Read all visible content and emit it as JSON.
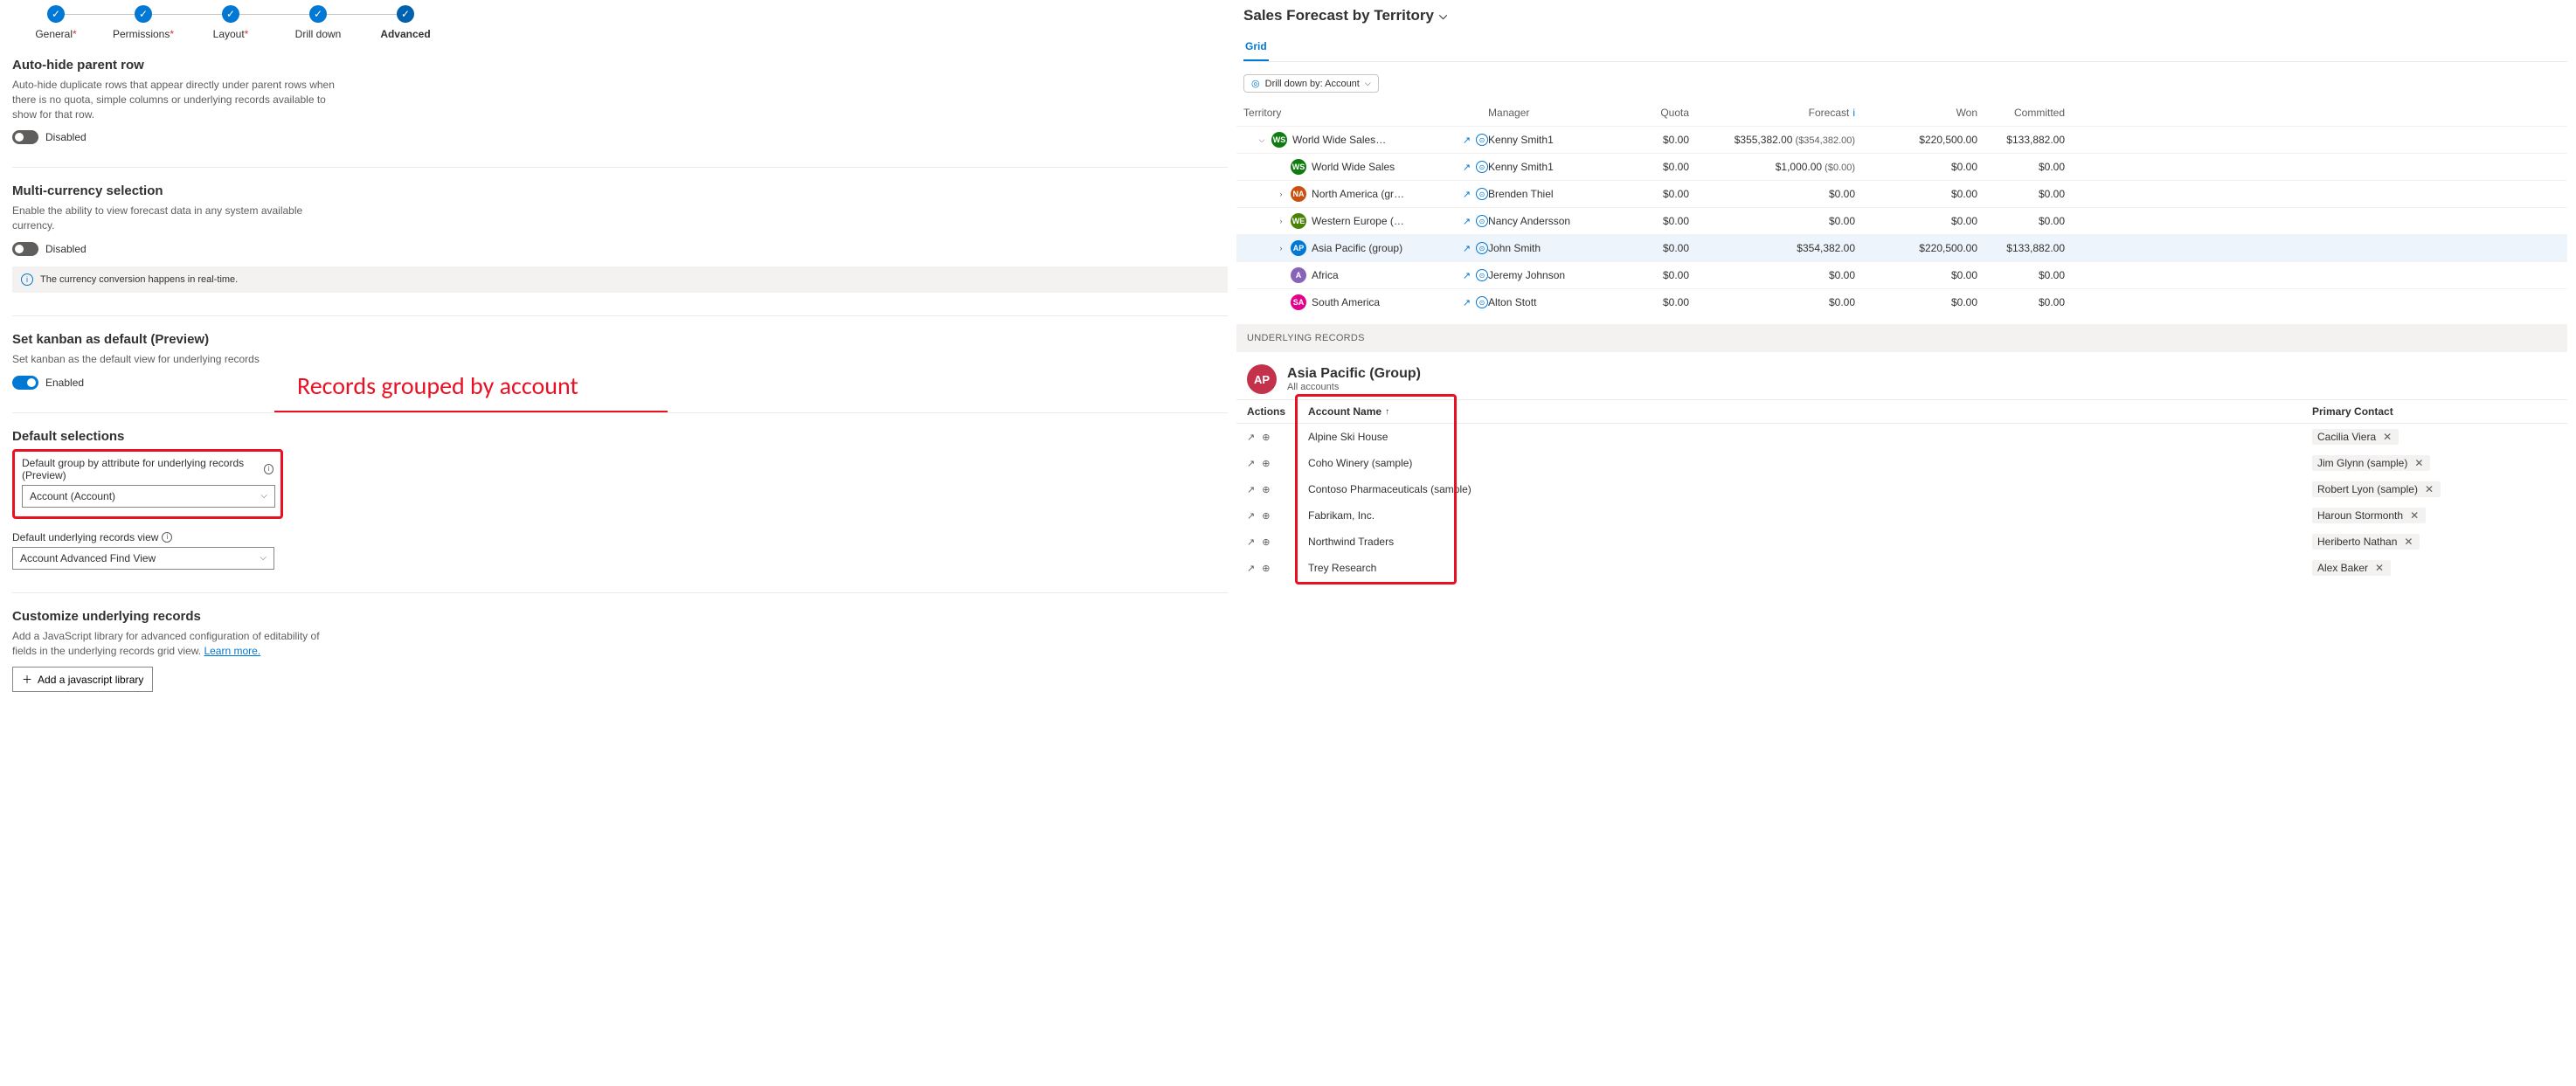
{
  "stepper": [
    {
      "label": "General",
      "req": true,
      "done": true,
      "current": false
    },
    {
      "label": "Permissions",
      "req": true,
      "done": true,
      "current": false
    },
    {
      "label": "Layout",
      "req": true,
      "done": true,
      "current": false
    },
    {
      "label": "Drill down",
      "req": false,
      "done": true,
      "current": false
    },
    {
      "label": "Advanced",
      "req": false,
      "done": true,
      "current": true
    }
  ],
  "sections": {
    "autoHide": {
      "title": "Auto-hide parent row",
      "desc": "Auto-hide duplicate rows that appear directly under parent rows when there is no quota, simple columns or underlying records available to show for that row.",
      "state": "Disabled"
    },
    "multiCurrency": {
      "title": "Multi-currency selection",
      "desc": "Enable the ability to view forecast data in any system available currency.",
      "state": "Disabled",
      "info": "The currency conversion happens in real-time."
    },
    "kanban": {
      "title": "Set kanban as default (Preview)",
      "desc": "Set kanban as the default view for underlying records",
      "state": "Enabled"
    },
    "defaultSel": {
      "title": "Default selections",
      "field1Label": "Default group by attribute for underlying records (Preview)",
      "field1Value": "Account (Account)",
      "field2Label": "Default underlying records view",
      "field2Value": "Account Advanced Find View"
    },
    "customize": {
      "title": "Customize underlying records",
      "desc": "Add a JavaScript library for advanced configuration of editability of fields in the underlying records grid view. ",
      "link": "Learn more.",
      "btn": "Add a javascript library"
    }
  },
  "annotation": "Records grouped by account",
  "rightPane": {
    "title": "Sales Forecast by Territory",
    "tab": "Grid",
    "drill": "Drill down by: Account",
    "gridHeaders": [
      "Territory",
      "Manager",
      "Quota",
      "Forecast",
      "Won",
      "Committed"
    ],
    "rows": [
      {
        "indent": 0,
        "chev": "down",
        "avColor": "#107c10",
        "avText": "WS",
        "name": "World Wide Sales (group)",
        "mgr": "Kenny Smith1",
        "quota": "$0.00",
        "forecast": "$355,382.00  ($354,382.00)",
        "won": "$220,500.00",
        "committed": "$133,882.00",
        "sel": false
      },
      {
        "indent": 1,
        "chev": "",
        "avColor": "#107c10",
        "avText": "WS",
        "name": "World Wide Sales",
        "mgr": "Kenny Smith1",
        "quota": "$0.00",
        "forecast": "$1,000.00  ($0.00)",
        "won": "$0.00",
        "committed": "$0.00",
        "sel": false
      },
      {
        "indent": 1,
        "chev": "right",
        "avColor": "#ca5010",
        "avText": "NA",
        "name": "North America (group)",
        "mgr": "Brenden Thiel",
        "quota": "$0.00",
        "forecast": "$0.00",
        "won": "$0.00",
        "committed": "$0.00",
        "sel": false
      },
      {
        "indent": 1,
        "chev": "right",
        "avColor": "#498205",
        "avText": "WE",
        "name": "Western Europe (group)",
        "mgr": "Nancy Andersson",
        "quota": "$0.00",
        "forecast": "$0.00",
        "won": "$0.00",
        "committed": "$0.00",
        "sel": false
      },
      {
        "indent": 1,
        "chev": "right",
        "avColor": "#0078d4",
        "avText": "AP",
        "name": "Asia Pacific (group)",
        "mgr": "John Smith",
        "quota": "$0.00",
        "forecast": "$354,382.00",
        "won": "$220,500.00",
        "committed": "$133,882.00",
        "sel": true
      },
      {
        "indent": 1,
        "chev": "",
        "avColor": "#8764b8",
        "avText": "A",
        "name": "Africa",
        "mgr": "Jeremy Johnson",
        "quota": "$0.00",
        "forecast": "$0.00",
        "won": "$0.00",
        "committed": "$0.00",
        "sel": false
      },
      {
        "indent": 1,
        "chev": "",
        "avColor": "#e3008c",
        "avText": "SA",
        "name": "South America",
        "mgr": "Alton Stott",
        "quota": "$0.00",
        "forecast": "$0.00",
        "won": "$0.00",
        "committed": "$0.00",
        "sel": false
      }
    ],
    "underlyingHeader": "UNDERLYING RECORDS",
    "group": {
      "avText": "AP",
      "title": "Asia Pacific (Group)",
      "sub": "All accounts"
    },
    "recHeaders": {
      "actions": "Actions",
      "accountName": "Account Name",
      "primaryContact": "Primary Contact"
    },
    "records": [
      {
        "name": "Alpine Ski House",
        "contact": "Cacilia Viera"
      },
      {
        "name": "Coho Winery (sample)",
        "contact": "Jim Glynn (sample)"
      },
      {
        "name": "Contoso Pharmaceuticals (sample)",
        "contact": "Robert Lyon (sample)"
      },
      {
        "name": "Fabrikam, Inc.",
        "contact": "Haroun Stormonth"
      },
      {
        "name": "Northwind Traders",
        "contact": "Heriberto Nathan"
      },
      {
        "name": "Trey Research",
        "contact": "Alex Baker"
      }
    ]
  }
}
